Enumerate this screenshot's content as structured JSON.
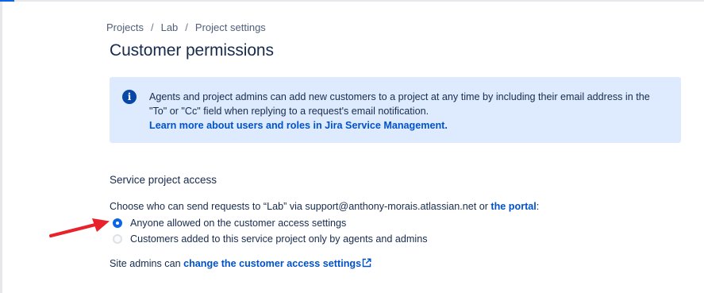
{
  "breadcrumb": {
    "items": [
      "Projects",
      "Lab",
      "Project settings"
    ],
    "separator": "/"
  },
  "page": {
    "title": "Customer permissions"
  },
  "info_panel": {
    "text": "Agents and project admins can add new customers to a project at any time by including their email address in the \"To\" or \"Cc\" field when replying to a request's email notification.",
    "link_label": "Learn more about users and roles in Jira Service Management.",
    "icon": "info-icon",
    "background_color": "#deebff"
  },
  "access": {
    "heading": "Service project access",
    "description": "Choose who can send requests to “Lab” via support@anthony-morais.atlassian.net or ",
    "portal_link": "the portal",
    "description_suffix": ":",
    "options": [
      {
        "label": "Anyone allowed on the customer access settings",
        "selected": true
      },
      {
        "label": "Customers added to this service project only by agents and admins",
        "selected": false
      }
    ],
    "site_admins_prefix": "Site admins can ",
    "site_admins_link": "change the customer access settings",
    "external_icon": "external-link-icon"
  },
  "annotation": {
    "icon": "red-arrow-icon",
    "color": "#e8212b"
  },
  "colors": {
    "link": "#0052cc",
    "accent": "#0c66e4",
    "text": "#172b4d"
  }
}
